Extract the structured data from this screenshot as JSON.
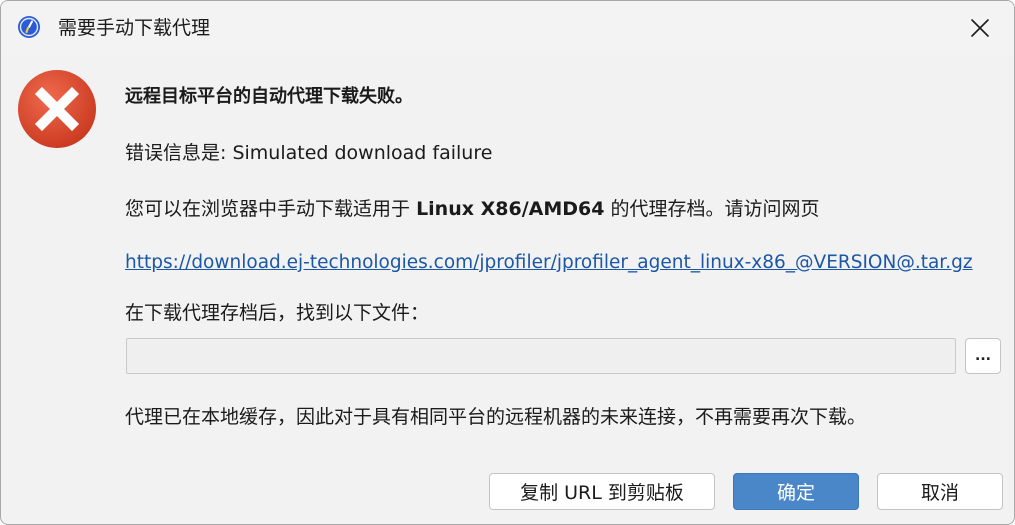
{
  "window": {
    "title": "需要手动下载代理",
    "icon": "jprofiler-app-icon",
    "close_icon": "close-icon"
  },
  "content": {
    "error_icon": "error-icon",
    "heading": "远程目标平台的自动代理下载失败。",
    "error_message": "错误信息是: Simulated download failure",
    "instruction_prefix": "您可以在浏览器中手动下载适用于",
    "instruction_platform": "Linux X86/AMD64",
    "instruction_suffix": "的代理存档。请访问网页",
    "download_url": "https://download.ej-technologies.com/jprofiler/jprofiler_agent_linux-x86_@VERSION@.tar.gz",
    "find_file_label": "在下载代理存档后，找到以下文件：",
    "file_path_value": "",
    "browse_label": "...",
    "cached_note": "代理已在本地缓存，因此对于具有相同平台的远程机器的未来连接，不再需要再次下载。"
  },
  "buttons": {
    "copy_url": "复制 URL 到剪贴板",
    "ok": "确定",
    "cancel": "取消"
  },
  "colors": {
    "link": "#1c57a6",
    "primary_button": "#4a87c8",
    "error_icon": "#d7402b"
  }
}
